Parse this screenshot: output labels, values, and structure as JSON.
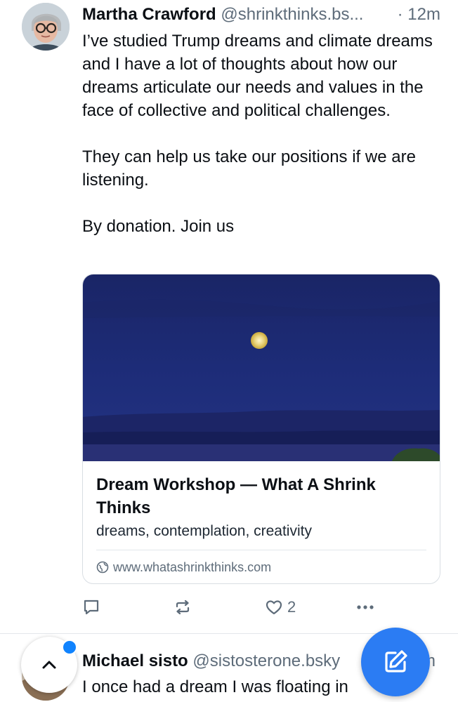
{
  "post": {
    "author_name": "Martha Crawford",
    "author_handle": "@shrinkthinks.bs...",
    "timestamp": "· 12m",
    "paragraphs": [
      "I’ve studied Trump dreams and climate dreams and I have a lot of thoughts about how our dreams articulate our needs and values in the face of collective and political challenges.",
      "They can help us take our positions if we are listening.",
      "By donation. Join us"
    ],
    "link_card": {
      "title": "Dream Workshop — What A Shrink Thinks",
      "description": "dreams, contemplation, creativity",
      "url": "www.whatashrinkthinks.com",
      "image_icon": "moon-over-sea-image"
    },
    "actions": {
      "reply_icon": "reply-icon",
      "repost_icon": "repost-icon",
      "like_icon": "heart-icon",
      "like_count": "2",
      "more_icon": "more-icon"
    }
  },
  "next_post": {
    "author_name": "Michael sisto",
    "author_handle": "@sistosterone.bsky",
    "timestamp": "m",
    "text": "I once had a dream I was floating in"
  },
  "floating": {
    "scroll_top_icon": "chevron-up-icon",
    "compose_icon": "compose-icon"
  },
  "colors": {
    "accent": "#2b7cf3",
    "text": "#0b0f14",
    "muted": "#5e6c7a",
    "notification": "#1083fe"
  }
}
